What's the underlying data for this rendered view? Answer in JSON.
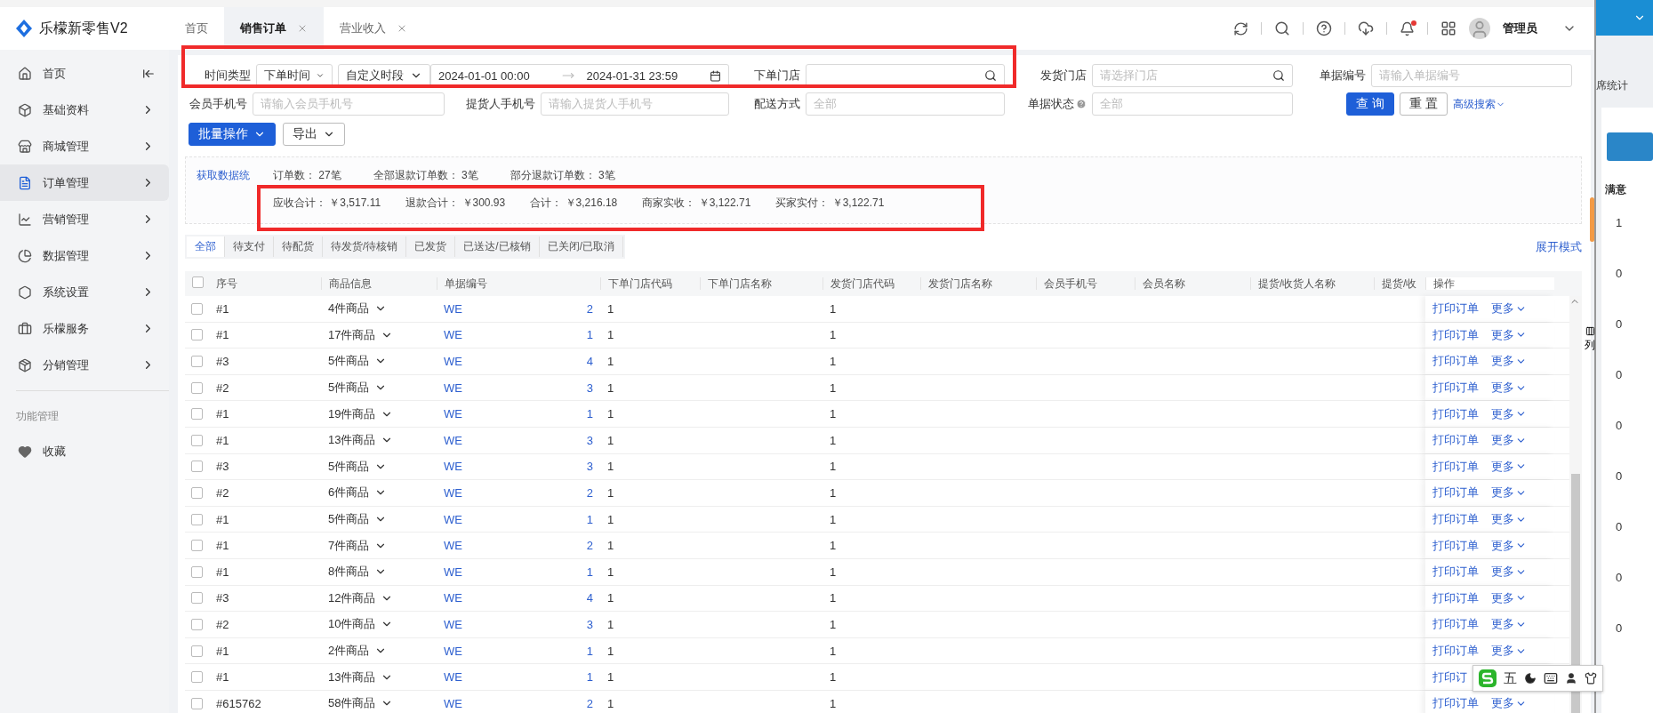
{
  "app": {
    "logo": "乐檬新零售V2"
  },
  "tabs": [
    {
      "label": "首页",
      "selected": false,
      "closable": false
    },
    {
      "label": "销售订单",
      "selected": true,
      "closable": true
    },
    {
      "label": "营业收入",
      "selected": false,
      "closable": true
    }
  ],
  "header": {
    "user": "管理员",
    "notification": true
  },
  "sidebar": {
    "items": [
      {
        "label": "首页",
        "selected": false,
        "kind": "collapse"
      },
      {
        "label": "基础资料",
        "selected": false,
        "kind": "menu"
      },
      {
        "label": "商城管理",
        "selected": false,
        "kind": "menu"
      },
      {
        "label": "订单管理",
        "selected": true,
        "kind": "menu"
      },
      {
        "label": "营销管理",
        "selected": false,
        "kind": "menu"
      },
      {
        "label": "数据管理",
        "selected": false,
        "kind": "menu"
      },
      {
        "label": "系统设置",
        "selected": false,
        "kind": "menu"
      },
      {
        "label": "乐檬服务",
        "selected": false,
        "kind": "menu"
      },
      {
        "label": "分销管理",
        "selected": false,
        "kind": "menu"
      }
    ],
    "section": "功能管理",
    "favorites": "收藏"
  },
  "filters": {
    "time_type": {
      "label": "时间类型",
      "value": "下单时间"
    },
    "period": {
      "value": "自定义时段",
      "start": "2024-01-01 00:00",
      "end": "2024-01-31 23:59"
    },
    "order_store": {
      "label": "下单门店"
    },
    "ship_store": {
      "label": "发货门店",
      "placeholder": "请选择门店"
    },
    "order_no": {
      "label": "单据编号",
      "placeholder": "请输入单据编号"
    },
    "member_phone": {
      "label": "会员手机号",
      "placeholder": "请输入会员手机号"
    },
    "pickup_phone": {
      "label": "提货人手机号",
      "placeholder": "请输入提货人手机号"
    },
    "delivery": {
      "label": "配送方式",
      "placeholder": "全部"
    },
    "status": {
      "label": "单据状态",
      "placeholder": "全部"
    },
    "query": "查 询",
    "reset": "重 置",
    "advanced": "高级搜索"
  },
  "actions": {
    "batch": "批量操作",
    "export": "导出"
  },
  "stats": {
    "link": "获取数据统",
    "line1": [
      {
        "label": "订单数：",
        "value": "27笔"
      },
      {
        "label": "全部退款订单数：",
        "value": "3笔"
      },
      {
        "label": "部分退款订单数：",
        "value": "3笔"
      }
    ],
    "line2": [
      {
        "label": "应收合计：",
        "value": "￥3,517.11"
      },
      {
        "label": "退款合计：",
        "value": "￥300.93"
      },
      {
        "label": "合计：",
        "value": "￥3,216.18"
      },
      {
        "label": "商家实收：",
        "value": "￥3,122.71"
      },
      {
        "label": "买家实付：",
        "value": "￥3,122.71"
      }
    ]
  },
  "status_tabs": [
    {
      "label": "全部",
      "selected": true
    },
    {
      "label": "待支付",
      "selected": false
    },
    {
      "label": "待配货",
      "selected": false
    },
    {
      "label": "待发货/待核销",
      "selected": false
    },
    {
      "label": "已发货",
      "selected": false
    },
    {
      "label": "已送达/已核销",
      "selected": false
    },
    {
      "label": "已关闭/已取消",
      "selected": false
    }
  ],
  "expand_mode": "展开模式",
  "table": {
    "columns": [
      "序号",
      "商品信息",
      "单据编号",
      "下单门店代码",
      "下单门店名称",
      "发货门店代码",
      "发货门店名称",
      "会员手机号",
      "会员名称",
      "提货/收货人名称",
      "提货/收",
      "操作"
    ],
    "column_button": "列",
    "all_checked": false,
    "rows": [
      {
        "checked": false,
        "seq": "#1",
        "goods": "4件商品",
        "order_head": "WE",
        "order_tail": "2",
        "store_code": "1",
        "ship_code": "1",
        "action": "打印订单",
        "more": "更多"
      },
      {
        "checked": false,
        "seq": "#1",
        "goods": "17件商品",
        "order_head": "WE",
        "order_tail": "1",
        "store_code": "1",
        "ship_code": "1",
        "action": "打印订单",
        "more": "更多"
      },
      {
        "checked": false,
        "seq": "#3",
        "goods": "5件商品",
        "order_head": "WE",
        "order_tail": "4",
        "store_code": "1",
        "ship_code": "1",
        "action": "打印订单",
        "more": "更多"
      },
      {
        "checked": false,
        "seq": "#2",
        "goods": "5件商品",
        "order_head": "WE",
        "order_tail": "3",
        "store_code": "1",
        "ship_code": "1",
        "action": "打印订单",
        "more": "更多"
      },
      {
        "checked": false,
        "seq": "#1",
        "goods": "19件商品",
        "order_head": "WE",
        "order_tail": "1",
        "store_code": "1",
        "ship_code": "1",
        "action": "打印订单",
        "more": "更多"
      },
      {
        "checked": false,
        "seq": "#1",
        "goods": "13件商品",
        "order_head": "WE",
        "order_tail": "3",
        "store_code": "1",
        "ship_code": "1",
        "action": "打印订单",
        "more": "更多"
      },
      {
        "checked": false,
        "seq": "#3",
        "goods": "5件商品",
        "order_head": "WE",
        "order_tail": "3",
        "store_code": "1",
        "ship_code": "1",
        "action": "打印订单",
        "more": "更多"
      },
      {
        "checked": false,
        "seq": "#2",
        "goods": "6件商品",
        "order_head": "WE",
        "order_tail": "2",
        "store_code": "1",
        "ship_code": "1",
        "action": "打印订单",
        "more": "更多"
      },
      {
        "checked": false,
        "seq": "#1",
        "goods": "5件商品",
        "order_head": "WE",
        "order_tail": "1",
        "store_code": "1",
        "ship_code": "1",
        "action": "打印订单",
        "more": "更多"
      },
      {
        "checked": false,
        "seq": "#1",
        "goods": "7件商品",
        "order_head": "WE",
        "order_tail": "2",
        "store_code": "1",
        "ship_code": "1",
        "action": "打印订单",
        "more": "更多"
      },
      {
        "checked": false,
        "seq": "#1",
        "goods": "8件商品",
        "order_head": "WE",
        "order_tail": "1",
        "store_code": "1",
        "ship_code": "1",
        "action": "打印订单",
        "more": "更多"
      },
      {
        "checked": false,
        "seq": "#3",
        "goods": "12件商品",
        "order_head": "WE",
        "order_tail": "4",
        "store_code": "1",
        "ship_code": "1",
        "action": "打印订单",
        "more": "更多"
      },
      {
        "checked": false,
        "seq": "#2",
        "goods": "10件商品",
        "order_head": "WE",
        "order_tail": "3",
        "store_code": "1",
        "ship_code": "1",
        "action": "打印订单",
        "more": "更多"
      },
      {
        "checked": false,
        "seq": "#1",
        "goods": "2件商品",
        "order_head": "WE",
        "order_tail": "1",
        "store_code": "1",
        "ship_code": "1",
        "action": "打印订单",
        "more": "更多"
      },
      {
        "checked": false,
        "seq": "#1",
        "goods": "13件商品",
        "order_head": "WE",
        "order_tail": "1",
        "store_code": "1",
        "ship_code": "1",
        "action": "打印订"
      },
      {
        "checked": false,
        "seq": "#615762",
        "goods": "58件商品",
        "order_head": "WE",
        "order_tail": "2",
        "store_code": "1",
        "ship_code": "1",
        "action": "打印订单",
        "more": "更多"
      }
    ]
  },
  "ime": {
    "label": "五"
  },
  "side_window": {
    "title": "席统计",
    "column": "满意",
    "values": [
      "1",
      "0",
      "0",
      "0",
      "0",
      "0",
      "0",
      "0",
      "0"
    ]
  }
}
